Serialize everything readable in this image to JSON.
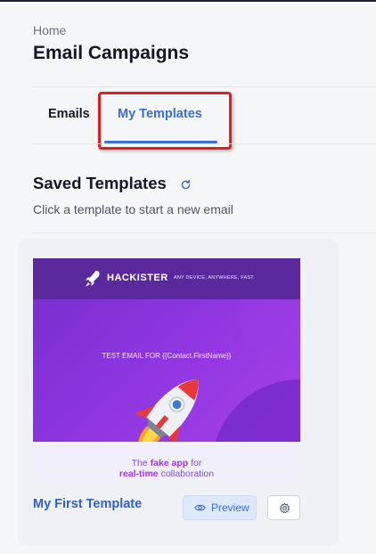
{
  "header": {
    "breadcrumb": "Home",
    "title": "Email Campaigns"
  },
  "tabs": [
    {
      "label": "Emails",
      "active": false
    },
    {
      "label": "My Templates",
      "active": true
    }
  ],
  "section": {
    "title": "Saved Templates",
    "subtitle": "Click a template to start a new email",
    "refresh_icon": "refresh-icon"
  },
  "templates": [
    {
      "name": "My First Template",
      "preview_label": "Preview",
      "preview_icon": "eye-icon",
      "settings_icon": "gear-icon",
      "thumbnail": {
        "brand": "HACKISTER",
        "tagline": "ANY DEVICE, ANYWHERE, FAST.",
        "headline": "TEST EMAIL FOR {{Contact.FirstName}}",
        "footer_prefix": "The ",
        "footer_bold1": "fake app",
        "footer_suffix1": " for",
        "footer_bold2": "real-time",
        "footer_suffix2": " collaboration"
      }
    }
  ],
  "colors": {
    "accent": "#3b6fd8",
    "highlight": "#e02020",
    "thumb_header": "#5a2a9c",
    "thumb_hero": "#8e36e0"
  }
}
